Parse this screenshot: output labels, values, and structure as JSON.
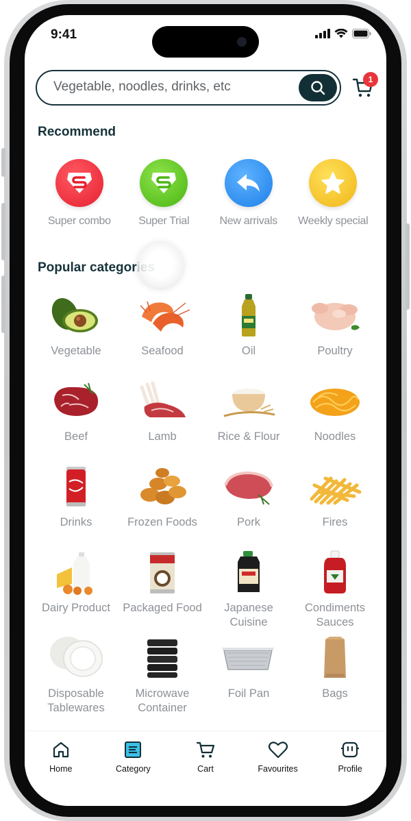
{
  "status_bar": {
    "time": "9:41"
  },
  "search": {
    "placeholder": "Vegetable, noodles, drinks, etc",
    "cart_count": "1"
  },
  "recommend": {
    "title": "Recommend",
    "items": [
      {
        "label": "Super combo",
        "icon": "shield-s-icon",
        "color": "#ee2f3d"
      },
      {
        "label": "Super Trial",
        "icon": "shield-s-icon",
        "color": "#58c11c"
      },
      {
        "label": "New arrivals",
        "icon": "reply-arrow-icon",
        "color": "#2f8ff0"
      },
      {
        "label": "Weekly special",
        "icon": "star-icon",
        "color": "#f2c11d"
      }
    ]
  },
  "categories": {
    "title": "Popular categories",
    "items": [
      {
        "label": "Vegetable",
        "icon": "avocado-icon"
      },
      {
        "label": "Seafood",
        "icon": "shrimp-icon"
      },
      {
        "label": "Oil",
        "icon": "oil-bottle-icon"
      },
      {
        "label": "Poultry",
        "icon": "chicken-icon"
      },
      {
        "label": "Beef",
        "icon": "beef-steak-icon"
      },
      {
        "label": "Lamb",
        "icon": "lamb-rack-icon"
      },
      {
        "label": "Rice & Flour",
        "icon": "rice-bowl-icon"
      },
      {
        "label": "Noodles",
        "icon": "noodles-icon"
      },
      {
        "label": "Drinks",
        "icon": "soda-can-icon"
      },
      {
        "label": "Frozen Foods",
        "icon": "nuggets-icon"
      },
      {
        "label": "Pork",
        "icon": "pork-icon"
      },
      {
        "label": "Fires",
        "icon": "fries-icon"
      },
      {
        "label": "Dairy Product",
        "icon": "dairy-icon"
      },
      {
        "label": "Packaged Food",
        "icon": "can-icon"
      },
      {
        "label": "Japanese Cuisine",
        "icon": "sauce-jug-icon"
      },
      {
        "label": "Condiments Sauces",
        "icon": "ketchup-icon"
      },
      {
        "label": "Disposable Tablewares",
        "icon": "plates-icon"
      },
      {
        "label": "Microwave Container",
        "icon": "containers-icon"
      },
      {
        "label": "Foil Pan",
        "icon": "foil-pan-icon"
      },
      {
        "label": "Bags",
        "icon": "paper-bag-icon"
      }
    ]
  },
  "tabbar": {
    "items": [
      {
        "label": "Home",
        "icon": "home-icon"
      },
      {
        "label": "Category",
        "icon": "category-icon",
        "active": true,
        "active_color": "#3cc0e8"
      },
      {
        "label": "Cart",
        "icon": "cart-icon"
      },
      {
        "label": "Favourites",
        "icon": "heart-icon"
      },
      {
        "label": "Profile",
        "icon": "profile-icon"
      }
    ]
  }
}
